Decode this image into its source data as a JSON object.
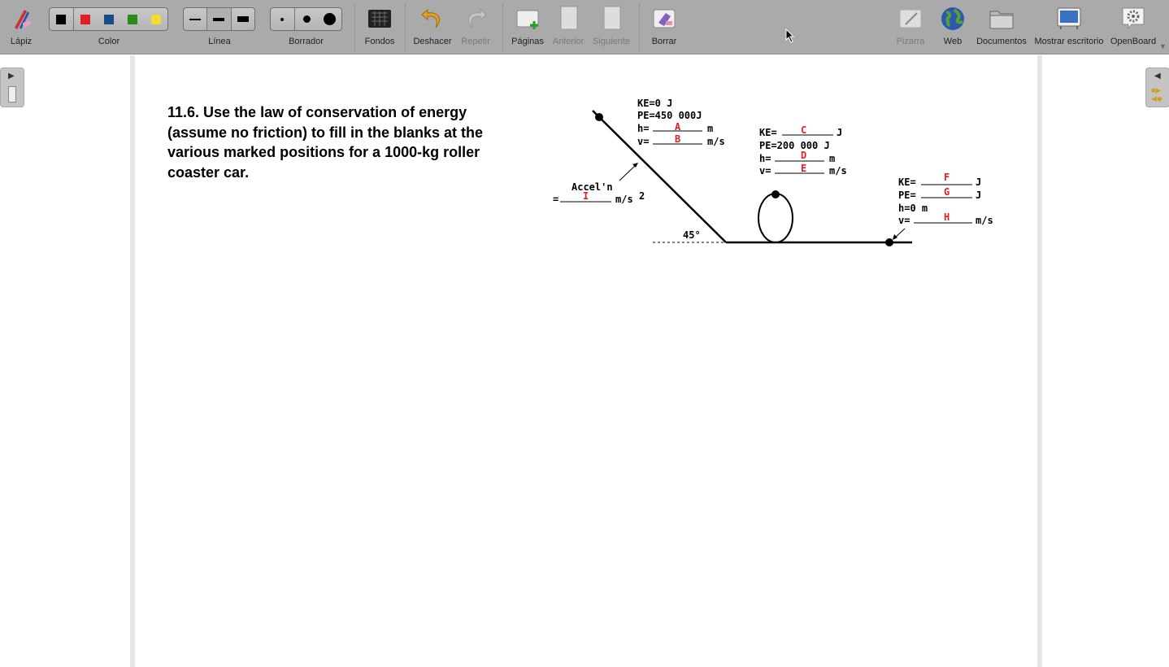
{
  "toolbar": {
    "pencil": "Lápiz",
    "color": "Color",
    "line": "Línea",
    "eraser": "Borrador",
    "backgrounds": "Fondos",
    "undo": "Deshacer",
    "redo": "Repetir",
    "pages": "Páginas",
    "previous": "Anterior",
    "next": "Siguiente",
    "clear": "Borrar",
    "board": "Pizarra",
    "web": "Web",
    "documents": "Documentos",
    "show_desktop": "Mostrar escritorio",
    "openboard": "OpenBoard",
    "colors": [
      "#000000",
      "#e02020",
      "#1a4a8a",
      "#2a8a1a",
      "#f0dc30"
    ]
  },
  "question": "11.6. Use the law of conservation of energy (assume no friction) to fill in the blanks at the various marked positions for a 1000-kg roller coaster car.",
  "diagram": {
    "top": {
      "ke": "KE=0 J",
      "pe": "PE=450 000J",
      "h": "h=",
      "h_blank": "A",
      "h_unit": "m",
      "v": "v=",
      "v_blank": "B",
      "v_unit": "m/s"
    },
    "loop": {
      "ke": "KE=",
      "ke_blank": "C",
      "ke_unit": "J",
      "pe": "PE=200 000 J",
      "h": "h=",
      "h_blank": "D",
      "h_unit": "m",
      "v": "v=",
      "v_blank": "E",
      "v_unit": "m/s"
    },
    "bottom": {
      "ke": "KE=",
      "ke_blank": "F",
      "ke_unit": "J",
      "pe": "PE=",
      "pe_blank": "G",
      "pe_unit": "J",
      "h": "h=0 m",
      "v": "v=",
      "v_blank": "H",
      "v_unit": "m/s"
    },
    "accel": {
      "label": "Accel'n",
      "eq": "=",
      "blank": "I",
      "unit": "m/s",
      "exp": "2"
    },
    "angle": "45°"
  }
}
